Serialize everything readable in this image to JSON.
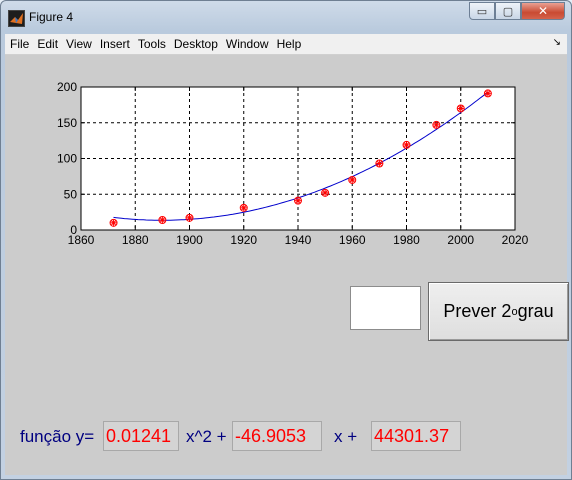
{
  "window": {
    "title": "Figure 4"
  },
  "window_buttons": {
    "minimize": "▭",
    "maximize": "▢",
    "close": "✕"
  },
  "menu": [
    "File",
    "Edit",
    "View",
    "Insert",
    "Tools",
    "Desktop",
    "Window",
    "Help"
  ],
  "menu_dock": "↘",
  "controls": {
    "input_value": "",
    "predict_button_main": "Prever 2",
    "predict_button_sup": "o",
    "predict_button_tail": "grau"
  },
  "formula": {
    "label_prefix": "função y=",
    "coef_a": "0.01241",
    "label_x2": "x^2 +",
    "coef_b": "-46.9053",
    "label_x": "x +",
    "coef_c": "44301.37"
  },
  "chart_data": {
    "type": "scatter",
    "title": "",
    "xlabel": "",
    "ylabel": "",
    "xlim": [
      1860,
      2020
    ],
    "ylim": [
      0,
      200
    ],
    "xticks": [
      1860,
      1880,
      1900,
      1920,
      1940,
      1960,
      1980,
      2000,
      2020
    ],
    "yticks": [
      0,
      50,
      100,
      150,
      200
    ],
    "grid": true,
    "grid_style": "dashed",
    "series": [
      {
        "kind": "points",
        "marker": "circle-star",
        "color": "#ff0000",
        "x": [
          1872,
          1890,
          1900,
          1920,
          1940,
          1950,
          1960,
          1970,
          1980,
          1991,
          2000,
          2010
        ],
        "y": [
          10,
          14,
          17,
          31,
          41,
          52,
          70,
          93,
          119,
          147,
          170,
          191
        ]
      },
      {
        "kind": "fit-curve",
        "color": "#0000cc",
        "x_from": 1872,
        "x_to": 2010,
        "coefficients": [
          0.01241,
          -46.9053,
          44301.37
        ]
      }
    ]
  }
}
